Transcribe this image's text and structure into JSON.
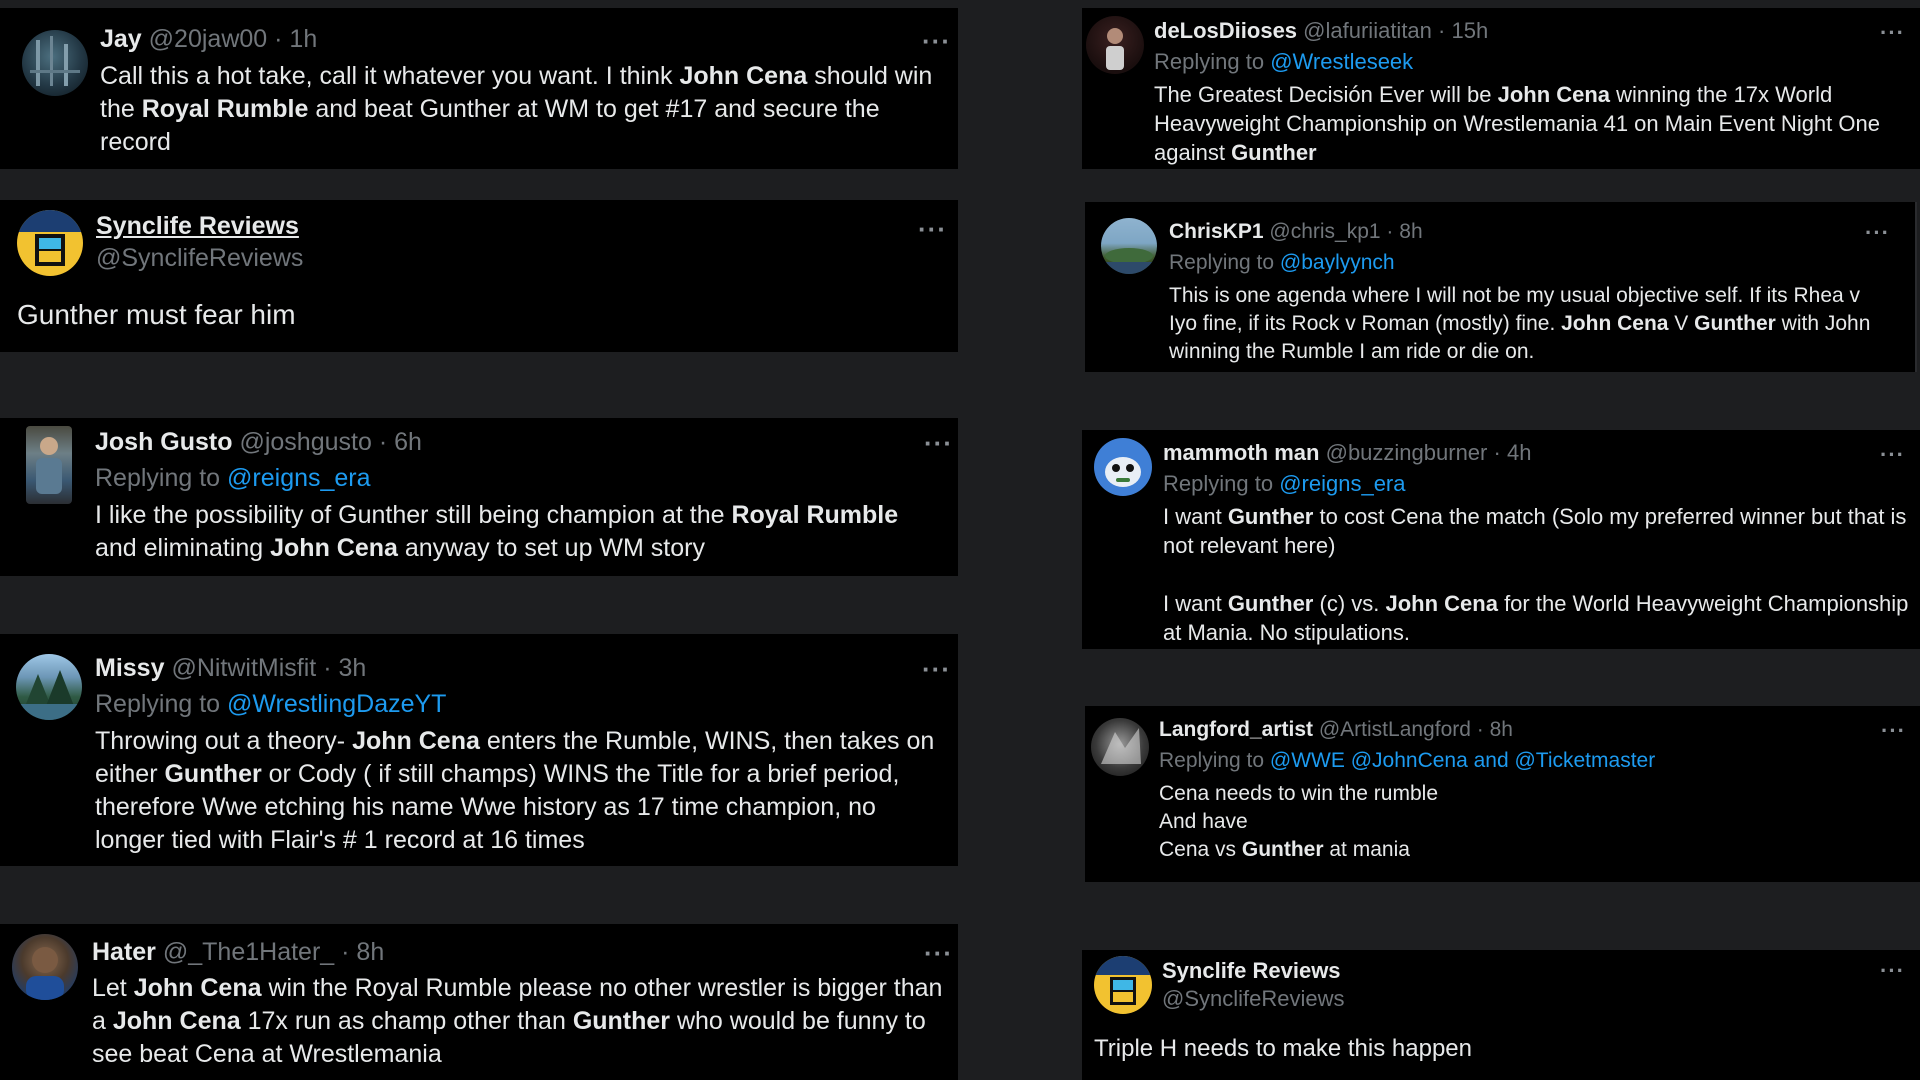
{
  "left_column": [
    {
      "name": "Jay",
      "handle": "@20jaw00",
      "time": "1h",
      "more": "···",
      "body": [
        {
          "t": "Call this a hot take, call it whatever you want. I think "
        },
        {
          "t": "John Cena",
          "b": true
        },
        {
          "t": " should win the "
        },
        {
          "t": "Royal Rumble",
          "b": true
        },
        {
          "t": " and beat Gunther at WM to get #17 and secure the record"
        }
      ]
    },
    {
      "name": "Synclife Reviews",
      "handle": "@SynclifeReviews",
      "more": "···",
      "body_plain": "Gunther must fear him"
    },
    {
      "name": "Josh Gusto",
      "handle": "@joshgusto",
      "time": "6h",
      "more": "···",
      "replying_to_label": "Replying to",
      "replying_to": "@reigns_era",
      "body": [
        {
          "t": "I like the possibility of Gunther still being champion at the "
        },
        {
          "t": "Royal Rumble",
          "b": true
        },
        {
          "t": " and eliminating "
        },
        {
          "t": "John Cena",
          "b": true
        },
        {
          "t": " anyway to set up WM story"
        }
      ]
    },
    {
      "name": "Missy",
      "handle": "@NitwitMisfit",
      "time": "3h",
      "more": "···",
      "replying_to_label": "Replying to",
      "replying_to": "@WrestlingDazeYT",
      "body": [
        {
          "t": "Throwing out a theory- "
        },
        {
          "t": "John Cena",
          "b": true
        },
        {
          "t": " enters the Rumble, WINS, then takes on either "
        },
        {
          "t": "Gunther",
          "b": true
        },
        {
          "t": " or Cody ( if still champs) WINS the Title for a brief period, therefore Wwe etching his name Wwe history as 17 time champion, no longer tied with Flair's # 1 record at 16 times"
        }
      ]
    },
    {
      "name": "Hater",
      "handle": "@_The1Hater_",
      "time": "8h",
      "more": "···",
      "body": [
        {
          "t": "Let "
        },
        {
          "t": "John Cena",
          "b": true
        },
        {
          "t": " win the Royal Rumble please no other wrestler is bigger than a "
        },
        {
          "t": "John Cena",
          "b": true
        },
        {
          "t": " 17x run as champ other than "
        },
        {
          "t": "Gunther",
          "b": true
        },
        {
          "t": " who would be funny to see beat Cena at Wrestlemania"
        }
      ]
    }
  ],
  "right_column": [
    {
      "name": "deLosDiioses",
      "handle": "@lafuriiatitan",
      "time": "15h",
      "more": "···",
      "replying_to_label": "Replying to",
      "replying_to": "@Wrestleseek",
      "body": [
        {
          "t": "The Greatest Decisión Ever will be "
        },
        {
          "t": "John Cena",
          "b": true
        },
        {
          "t": " winning the 17x World Heavyweight Championship on Wrestlemania 41 on Main Event Night One against "
        },
        {
          "t": "Gunther",
          "b": true
        }
      ]
    },
    {
      "name": "ChrisKP1",
      "handle": "@chris_kp1",
      "time": "8h",
      "more": "···",
      "replying_to_label": "Replying to",
      "replying_to": "@baylyynch",
      "body": [
        {
          "t": "This is one agenda where I will not be my usual objective self. If its Rhea v Iyo fine, if its Rock v Roman (mostly) fine.  "
        },
        {
          "t": "John Cena",
          "b": true
        },
        {
          "t": " V "
        },
        {
          "t": "Gunther",
          "b": true
        },
        {
          "t": " with John winning the Rumble I am ride or die on."
        }
      ]
    },
    {
      "name": "mammoth man",
      "handle": "@buzzingburner",
      "time": "4h",
      "more": "···",
      "replying_to_label": "Replying to",
      "replying_to": "@reigns_era",
      "body": [
        {
          "t": "I want "
        },
        {
          "t": "Gunther",
          "b": true
        },
        {
          "t": " to cost Cena the match (Solo my preferred winner but that is not relevant here)"
        },
        {
          "br": true
        },
        {
          "br": true
        },
        {
          "t": "I want "
        },
        {
          "t": "Gunther",
          "b": true
        },
        {
          "t": " (c) vs. "
        },
        {
          "t": "John Cena",
          "b": true
        },
        {
          "t": " for the World Heavyweight Championship at Mania. No stipulations."
        }
      ]
    },
    {
      "name": "Langford_artist",
      "handle": "@ArtistLangford",
      "time": "8h",
      "more": "···",
      "replying_to_label": "Replying to",
      "replying_to": "@WWE @JohnCena and @Ticketmaster",
      "body": [
        {
          "t": "Cena needs to win the rumble"
        },
        {
          "br": true
        },
        {
          "t": "And have"
        },
        {
          "br": true
        },
        {
          "t": "Cena vs "
        },
        {
          "t": "Gunther",
          "b": true
        },
        {
          "t": " at mania"
        }
      ]
    },
    {
      "name": "Synclife Reviews",
      "handle": "@SynclifeReviews",
      "more": "···",
      "body_plain": "Triple H needs to make this happen"
    }
  ],
  "colors": {
    "background": "#1d1e20",
    "card": "#000000",
    "text": "#e7e9ea",
    "muted": "#71767b",
    "link": "#1d9bf0"
  }
}
